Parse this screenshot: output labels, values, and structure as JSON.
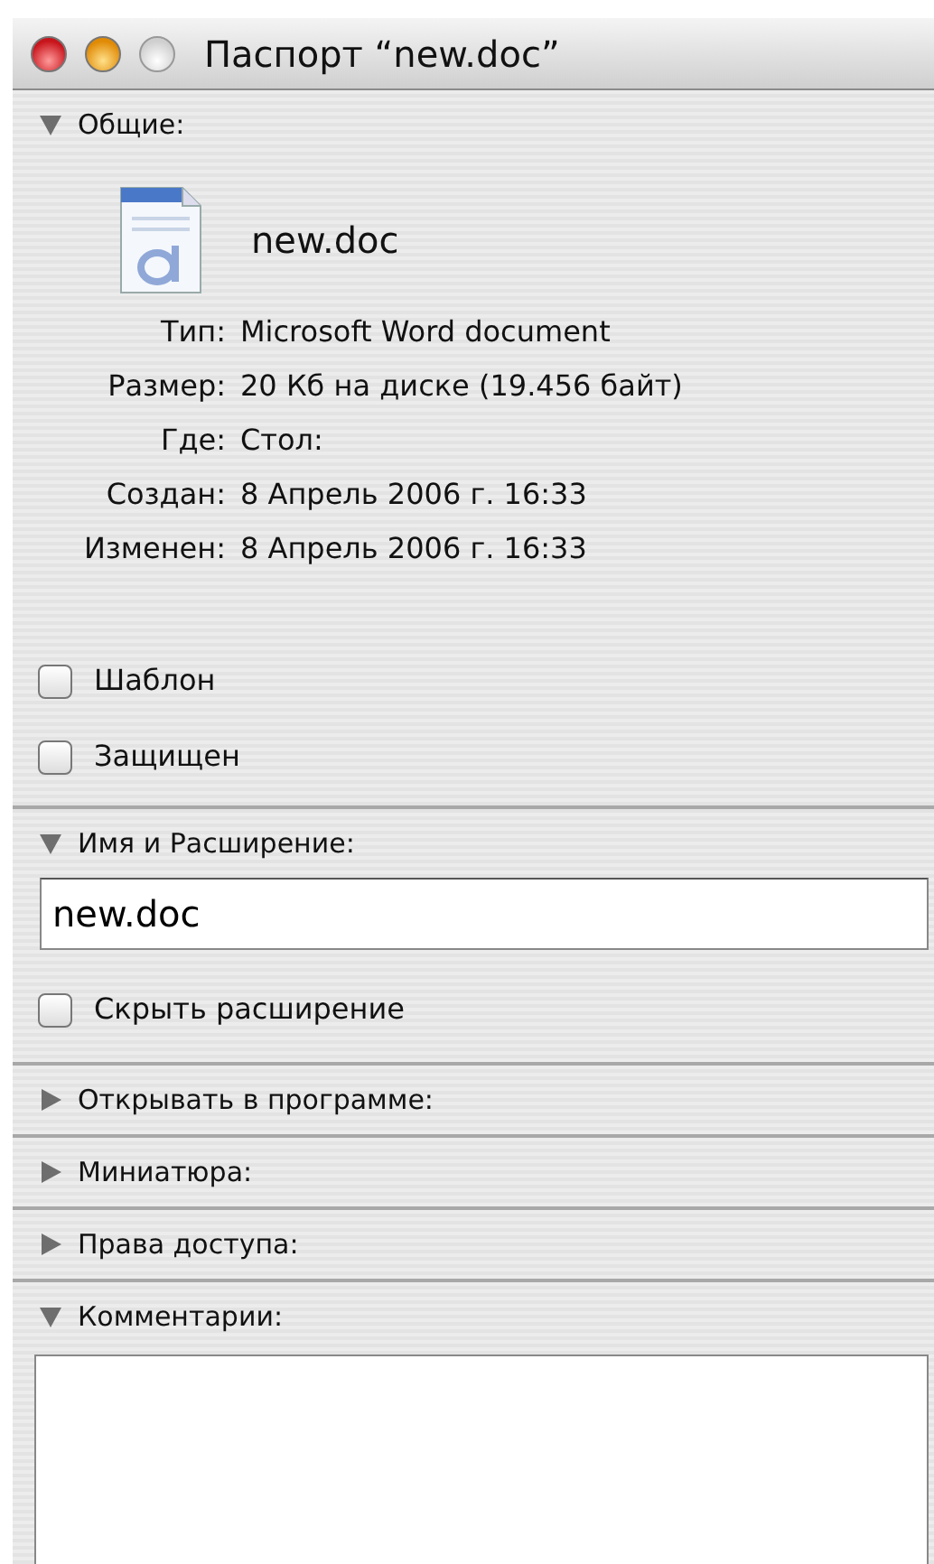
{
  "window": {
    "title": "Паспорт “new.doc”"
  },
  "sections": [
    {
      "kind": "general",
      "title": "Общие:",
      "expanded": true,
      "file_name": "new.doc",
      "info": [
        {
          "label": "Тип:",
          "value": "Microsoft Word document"
        },
        {
          "label": "Размер:",
          "value": "20 Кб на диске (19.456 байт)"
        },
        {
          "label": "Где:",
          "value": "Стол:"
        },
        {
          "label": "Создан:",
          "value": "8 Апрель 2006 г. 16:33"
        },
        {
          "label": "Изменен:",
          "value": "8 Апрель 2006 г. 16:33"
        }
      ],
      "options": [
        {
          "label": "Шаблон",
          "checked": false
        },
        {
          "label": "Защищен",
          "checked": false
        }
      ]
    },
    {
      "kind": "name",
      "title": "Имя и Расширение:",
      "expanded": true,
      "value": "new.doc",
      "options": [
        {
          "label": "Скрыть расширение",
          "checked": false
        }
      ]
    },
    {
      "title": "Открывать в программе:",
      "expanded": false
    },
    {
      "title": "Миниатюра:",
      "expanded": false
    },
    {
      "title": "Права доступа:",
      "expanded": false
    },
    {
      "kind": "comments",
      "title": "Комментарии:",
      "expanded": true
    }
  ]
}
